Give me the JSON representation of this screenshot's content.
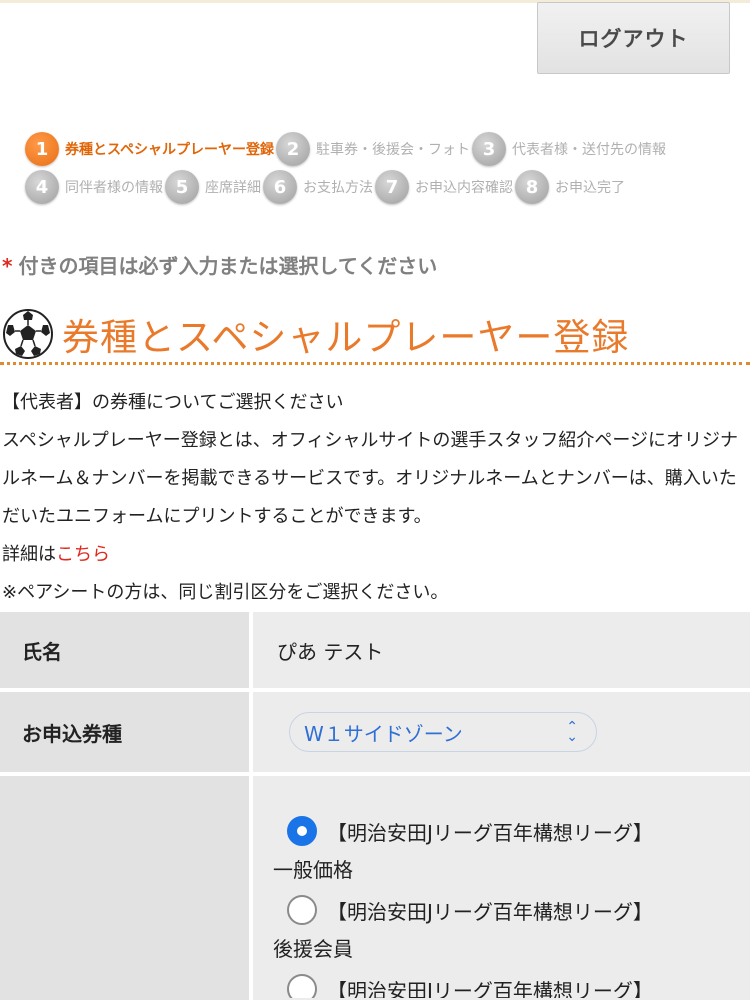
{
  "header": {
    "logout_label": "ログアウト"
  },
  "steps": {
    "row1": [
      {
        "num": "1",
        "label": "券種とスペシャルプレーヤー登録",
        "active": true
      },
      {
        "num": "2",
        "label": "駐車券・後援会・フォト",
        "active": false
      },
      {
        "num": "3",
        "label": "代表者様・送付先の情報",
        "active": false
      }
    ],
    "row2": [
      {
        "num": "4",
        "label": "同伴者様の情報",
        "active": false
      },
      {
        "num": "5",
        "label": "座席詳細",
        "active": false
      },
      {
        "num": "6",
        "label": "お支払方法",
        "active": false
      },
      {
        "num": "7",
        "label": "お申込内容確認",
        "active": false
      },
      {
        "num": "8",
        "label": "お申込完了",
        "active": false
      }
    ]
  },
  "notice": {
    "star": "*",
    "text": "付きの項目は必ず入力または選択してください"
  },
  "section": {
    "icon": "soccer-ball-icon",
    "title": "券種とスペシャルプレーヤー登録"
  },
  "description": {
    "line1": "【代表者】の券種についてご選択ください",
    "paragraph": "スペシャルプレーヤー登録とは、オフィシャルサイトの選手スタッフ紹介ページにオリジナルネーム＆ナンバーを掲載できるサービスです。オリジナルネームとナンバーは、購入いただいたユニフォームにプリントすることができます。",
    "detail_prefix": "詳細は",
    "detail_link": "こちら",
    "pair_note": "※ペアシートの方は、同じ割引区分をご選択ください。"
  },
  "form": {
    "name_label": "氏名",
    "name_value": "ぴあ テスト",
    "ticket_label": "お申込券種",
    "ticket_value": "W１サイドゾーン",
    "options": [
      {
        "text": "【明治安田Jリーグ百年構想リーグ】",
        "sub": "一般価格",
        "checked": true
      },
      {
        "text": "【明治安田Jリーグ百年構想リーグ】",
        "sub": "後援会員",
        "checked": false
      },
      {
        "text": "【明治安田Jリーグ百年構想リーグ】",
        "sub": "",
        "checked": false
      }
    ]
  },
  "colors": {
    "accent": "#ea7a2b",
    "active_step": "#e86f14",
    "required": "#e0281e",
    "link": "#e0281e",
    "select_text": "#2f6fd6",
    "radio_checked": "#1a74e8"
  }
}
